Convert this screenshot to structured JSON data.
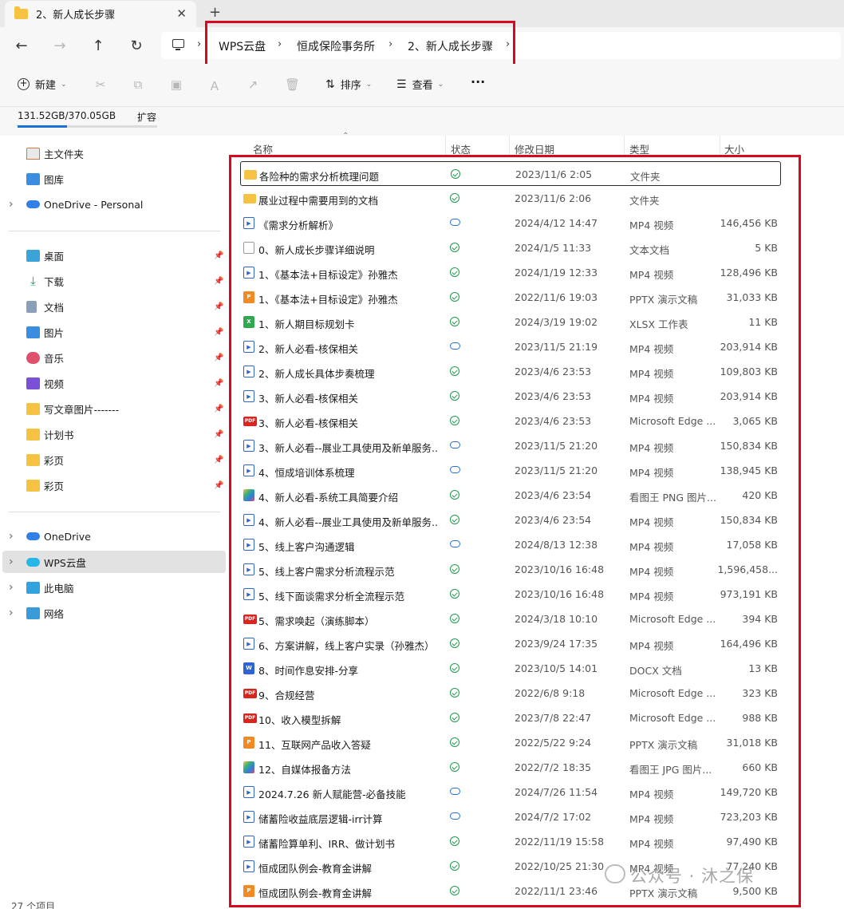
{
  "tab": {
    "title": "2、新人成长步骤",
    "close": "✕",
    "new": "+"
  },
  "nav": {
    "back": "←",
    "forward": "→",
    "up": "↑",
    "refresh": "↻"
  },
  "breadcrumb": [
    "WPS云盘",
    "恒成保险事务所",
    "2、新人成长步骤"
  ],
  "breadcrumb_sep": "›",
  "toolbar": {
    "new": "新建",
    "sort": "排序",
    "view": "查看",
    "more": "···"
  },
  "storage": {
    "text": "131.52GB/370.05GB",
    "expand": "扩容",
    "used_fraction": 0.355
  },
  "sidebar": {
    "top": [
      {
        "label": "主文件夹",
        "icon": "home-icon"
      },
      {
        "label": "图库",
        "icon": "gallery-icon"
      },
      {
        "label": "OneDrive - Personal",
        "icon": "onedrive-icon"
      }
    ],
    "quick": [
      {
        "label": "桌面",
        "icon": "desktop-icon"
      },
      {
        "label": "下载",
        "icon": "download-icon"
      },
      {
        "label": "文档",
        "icon": "documents-icon"
      },
      {
        "label": "图片",
        "icon": "pictures-icon"
      },
      {
        "label": "音乐",
        "icon": "music-icon"
      },
      {
        "label": "视频",
        "icon": "videos-icon"
      },
      {
        "label": "写文章图片-------",
        "icon": "folder-icon"
      },
      {
        "label": "计划书",
        "icon": "folder-icon"
      },
      {
        "label": "彩页",
        "icon": "folder-icon"
      },
      {
        "label": "彩页",
        "icon": "folder-icon"
      }
    ],
    "bottom": [
      {
        "label": "OneDrive",
        "icon": "onedrive-icon"
      },
      {
        "label": "WPS云盘",
        "icon": "wps-cloud-icon"
      },
      {
        "label": "此电脑",
        "icon": "this-pc-icon"
      },
      {
        "label": "网络",
        "icon": "network-icon"
      }
    ]
  },
  "columns": {
    "name": "名称",
    "status": "状态",
    "date": "修改日期",
    "type": "类型",
    "size": "大小"
  },
  "files": [
    {
      "name": "各险种的需求分析梳理问题",
      "kind": "folder",
      "status": "ok",
      "date": "2023/11/6 2:05",
      "type": "文件夹",
      "size": ""
    },
    {
      "name": "展业过程中需要用到的文档",
      "kind": "folder",
      "status": "ok",
      "date": "2023/11/6 2:06",
      "type": "文件夹",
      "size": ""
    },
    {
      "name": "《需求分析解析》",
      "kind": "mp4",
      "status": "cloud",
      "date": "2024/4/12 14:47",
      "type": "MP4 视频",
      "size": "146,456 KB"
    },
    {
      "name": "0、新人成长步骤详细说明",
      "kind": "txt",
      "status": "ok",
      "date": "2024/1/5 11:33",
      "type": "文本文档",
      "size": "5 KB"
    },
    {
      "name": "1、《基本法+目标设定》孙雅杰",
      "kind": "mp4",
      "status": "ok",
      "date": "2024/1/19 12:33",
      "type": "MP4 视频",
      "size": "128,496 KB"
    },
    {
      "name": "1、《基本法+目标设定》孙雅杰",
      "kind": "pptx",
      "status": "ok",
      "date": "2022/11/6 19:03",
      "type": "PPTX 演示文稿",
      "size": "31,033 KB"
    },
    {
      "name": "1、新人期目标规划卡",
      "kind": "xlsx",
      "status": "ok",
      "date": "2024/3/19 19:02",
      "type": "XLSX 工作表",
      "size": "11 KB"
    },
    {
      "name": "2、新人必看-核保相关",
      "kind": "mp4",
      "status": "cloud",
      "date": "2023/11/5 21:19",
      "type": "MP4 视频",
      "size": "203,914 KB"
    },
    {
      "name": "2、新人成长具体步奏梳理",
      "kind": "mp4",
      "status": "ok",
      "date": "2023/4/6 23:53",
      "type": "MP4 视频",
      "size": "109,803 KB"
    },
    {
      "name": "3、新人必看-核保相关",
      "kind": "mp4",
      "status": "ok",
      "date": "2023/4/6 23:53",
      "type": "MP4 视频",
      "size": "203,914 KB"
    },
    {
      "name": "3、新人必看-核保相关",
      "kind": "pdf",
      "status": "ok",
      "date": "2023/4/6 23:53",
      "type": "Microsoft Edge ...",
      "size": "3,065 KB"
    },
    {
      "name": "3、新人必看--展业工具使用及新单服务...",
      "kind": "mp4",
      "status": "cloud",
      "date": "2023/11/5 21:20",
      "type": "MP4 视频",
      "size": "150,834 KB"
    },
    {
      "name": "4、恒成培训体系梳理",
      "kind": "mp4",
      "status": "cloud",
      "date": "2023/11/5 21:20",
      "type": "MP4 视频",
      "size": "138,945 KB"
    },
    {
      "name": "4、新人必看-系统工具简要介绍",
      "kind": "img",
      "status": "ok",
      "date": "2023/4/6 23:54",
      "type": "看图王 PNG 图片...",
      "size": "420 KB"
    },
    {
      "name": "4、新人必看--展业工具使用及新单服务...",
      "kind": "mp4",
      "status": "ok",
      "date": "2023/4/6 23:54",
      "type": "MP4 视频",
      "size": "150,834 KB"
    },
    {
      "name": "5、线上客户沟通逻辑",
      "kind": "mp4",
      "status": "cloud",
      "date": "2024/8/13 12:38",
      "type": "MP4 视频",
      "size": "17,058 KB"
    },
    {
      "name": "5、线上客户需求分析流程示范",
      "kind": "mp4",
      "status": "ok",
      "date": "2023/10/16 16:48",
      "type": "MP4 视频",
      "size": "1,596,458..."
    },
    {
      "name": "5、线下面谈需求分析全流程示范",
      "kind": "mp4",
      "status": "ok",
      "date": "2023/10/16 16:48",
      "type": "MP4 视频",
      "size": "973,191 KB"
    },
    {
      "name": "5、需求唤起（演练脚本）",
      "kind": "pdf",
      "status": "ok",
      "date": "2024/3/18 10:10",
      "type": "Microsoft Edge ...",
      "size": "394 KB"
    },
    {
      "name": "6、方案讲解，线上客户实录（孙雅杰）",
      "kind": "mp4",
      "status": "ok",
      "date": "2023/9/24 17:35",
      "type": "MP4 视频",
      "size": "164,496 KB"
    },
    {
      "name": "8、时间作息安排-分享",
      "kind": "docx",
      "status": "ok",
      "date": "2023/10/5 14:01",
      "type": "DOCX 文档",
      "size": "13 KB"
    },
    {
      "name": "9、合规经营",
      "kind": "pdf",
      "status": "ok",
      "date": "2022/6/8 9:18",
      "type": "Microsoft Edge ...",
      "size": "323 KB"
    },
    {
      "name": "10、收入模型拆解",
      "kind": "pdf",
      "status": "ok",
      "date": "2023/7/8 22:47",
      "type": "Microsoft Edge ...",
      "size": "988 KB"
    },
    {
      "name": "11、互联网产品收入答疑",
      "kind": "pptx",
      "status": "ok",
      "date": "2022/5/22 9:24",
      "type": "PPTX 演示文稿",
      "size": "31,018 KB"
    },
    {
      "name": "12、自媒体报备方法",
      "kind": "img",
      "status": "ok",
      "date": "2022/7/2 18:35",
      "type": "看图王 JPG 图片...",
      "size": "660 KB"
    },
    {
      "name": "2024.7.26 新人赋能营-必备技能",
      "kind": "mp4",
      "status": "cloud",
      "date": "2024/7/26 11:54",
      "type": "MP4 视频",
      "size": "149,720 KB"
    },
    {
      "name": "储蓄险收益底层逻辑-irr计算",
      "kind": "mp4",
      "status": "cloud",
      "date": "2024/7/2 17:02",
      "type": "MP4 视频",
      "size": "723,203 KB"
    },
    {
      "name": "储蓄险算单利、IRR、做计划书",
      "kind": "mp4",
      "status": "ok",
      "date": "2022/11/19 15:58",
      "type": "MP4 视频",
      "size": "97,490 KB"
    },
    {
      "name": "恒成团队例会-教育金讲解",
      "kind": "mp4",
      "status": "ok",
      "date": "2022/10/25 21:30",
      "type": "MP4 视频",
      "size": "77,240 KB"
    },
    {
      "name": "恒成团队例会-教育金讲解",
      "kind": "pptx",
      "status": "ok",
      "date": "2022/11/1 23:46",
      "type": "PPTX 演示文稿",
      "size": "9,500 KB"
    }
  ],
  "item_count": "27 个项目",
  "watermark": "公众号 · 沐之保"
}
